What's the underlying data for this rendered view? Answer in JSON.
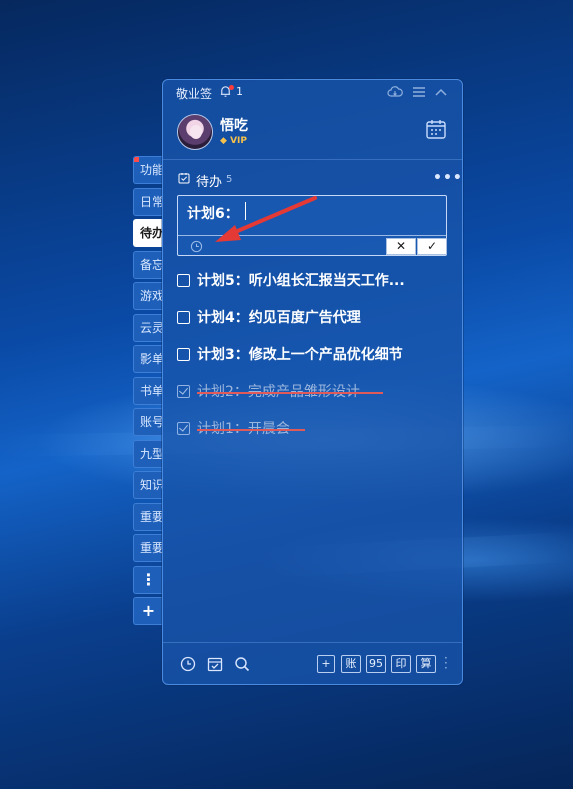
{
  "app": {
    "title": "敬业签",
    "notification_count": "1"
  },
  "user": {
    "name": "悟吃",
    "badge": "VIP"
  },
  "side_tabs": [
    {
      "label": "功能",
      "flag": true,
      "active": false
    },
    {
      "label": "日常",
      "flag": false,
      "active": false
    },
    {
      "label": "待办",
      "flag": false,
      "active": true
    },
    {
      "label": "备忘",
      "flag": false,
      "active": false
    },
    {
      "label": "游戏",
      "flag": false,
      "active": false
    },
    {
      "label": "云灵",
      "flag": false,
      "active": false
    },
    {
      "label": "影单",
      "flag": false,
      "active": false
    },
    {
      "label": "书单",
      "flag": false,
      "active": false
    },
    {
      "label": "账号",
      "flag": false,
      "active": false
    },
    {
      "label": "九型",
      "flag": false,
      "active": false
    },
    {
      "label": "知识",
      "flag": false,
      "active": false
    },
    {
      "label": "重要",
      "flag": false,
      "active": false
    },
    {
      "label": "重要",
      "flag": false,
      "active": false
    }
  ],
  "side_tab_more": "⋮",
  "side_tab_add": "+",
  "section": {
    "title": "待办",
    "count": "5",
    "more": "•••"
  },
  "editor": {
    "value": "计划6：",
    "cancel": "✕",
    "confirm": "✓"
  },
  "todos": [
    {
      "text": "计划5：听小组长汇报当天工作...",
      "done": false
    },
    {
      "text": "计划4：约见百度广告代理",
      "done": false
    },
    {
      "text": "计划3：修改上一个产品优化细节",
      "done": false
    },
    {
      "text": "计划2：完成产品雏形设计",
      "done": true
    },
    {
      "text": "计划1：开晨会",
      "done": true
    }
  ],
  "footer": {
    "buttons": {
      "add": "+",
      "ledger": "账",
      "five_nine": "95",
      "print": "印",
      "calc": "算"
    },
    "more": "⋮"
  },
  "colors": {
    "accent": "#1e5fba",
    "panel": "#1854aa",
    "arrow": "#e53935",
    "strike": "#e05a5a",
    "vip": "#f6c14b"
  },
  "icons": [
    "bell-icon",
    "cloud-icon",
    "menu-icon",
    "collapse-icon",
    "calendar-icon",
    "checklist-icon",
    "clock-icon",
    "search-icon"
  ]
}
